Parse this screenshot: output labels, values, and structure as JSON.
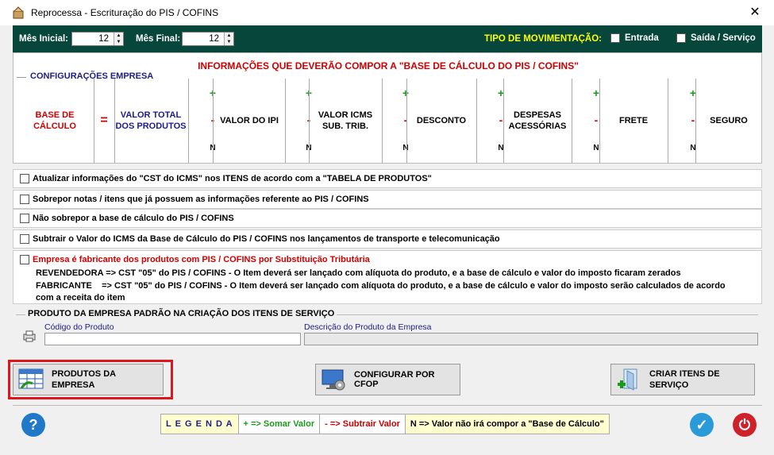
{
  "window": {
    "title": "Reprocessa - Escrituração do PIS / COFINS",
    "close": "✕"
  },
  "topbar": {
    "mes_inicial_label": "Mês Inicial:",
    "mes_inicial_value": "12",
    "mes_final_label": "Mês Final:",
    "mes_final_value": "12",
    "tipo_label": "TIPO DE MOVIMENTAÇÃO:",
    "entrada_label": "Entrada",
    "saida_label": "Saída / Serviço"
  },
  "panel": {
    "info_title": "INFORMAÇÕES QUE DEVERÃO COMPOR A \"BASE DE CÁLCULO DO PIS / COFINS\"",
    "group_title": "CONFIGURAÇÕES  EMPRESA",
    "base_label": "BASE DE CÁLCULO",
    "equals": "=",
    "valor_total": "VALOR TOTAL DOS PRODUTOS",
    "plus": "+",
    "minus": "-",
    "n": "N",
    "columns": [
      "VALOR DO IPI",
      "VALOR ICMS SUB. TRIB.",
      "DESCONTO",
      "DESPESAS ACESSÓRIAS",
      "FRETE",
      "SEGURO"
    ]
  },
  "options": [
    "Atualizar informações do \"CST do ICMS\" nos ITENS de acordo com a \"TABELA DE PRODUTOS\"",
    "Sobrepor notas / itens que já possuem as informações referente ao PIS / COFINS",
    "Não sobrepor a base de cálculo do PIS / COFINS",
    "Subtrair o Valor do ICMS da Base de Cálculo do PIS / COFINS nos lançamentos de transporte e telecomunicação"
  ],
  "fabricante": {
    "label": "Empresa é fabricante dos produtos com PIS / COFINS por Substituição Tributária",
    "line1": "REVENDEDORA => CST \"05\" do PIS / COFINS - O Item deverá ser lançado com alíquota do produto, e a base de cálculo e valor do imposto ficaram zerados",
    "line2": "FABRICANTE    => CST \"05\" do PIS / COFINS - O Item deverá ser lançado com alíquota do produto, e a base de cálculo e valor do imposto serão calculados de acordo",
    "line3": "com a receita do item"
  },
  "produto": {
    "title": "PRODUTO DA EMPRESA PADRÃO NA CRIAÇÃO DOS ITENS DE SERVIÇO",
    "codigo_label": "Código do Produto",
    "descricao_label": "Descrição do Produto da Empresa"
  },
  "buttons": {
    "produtos": "PRODUTOS DA EMPRESA",
    "configurar": "CONFIGURAR POR CFOP",
    "criar": "CRIAR ITENS DE SERVIÇO"
  },
  "legend": {
    "title": "L E G E N D A",
    "plus": "+  => Somar Valor",
    "minus": "-  => Subtrair Valor",
    "n": "N => Valor não irá compor a \"Base de Cálculo\""
  },
  "colors": {
    "header_bg": "#07463a",
    "accent_red": "#d00000",
    "accent_blue": "#1c1c8a"
  }
}
